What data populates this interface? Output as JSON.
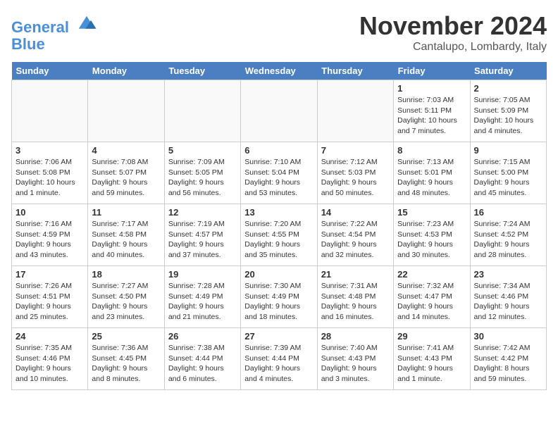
{
  "logo": {
    "line1": "General",
    "line2": "Blue"
  },
  "title": "November 2024",
  "location": "Cantalupo, Lombardy, Italy",
  "days_header": [
    "Sunday",
    "Monday",
    "Tuesday",
    "Wednesday",
    "Thursday",
    "Friday",
    "Saturday"
  ],
  "weeks": [
    [
      {
        "day": "",
        "info": ""
      },
      {
        "day": "",
        "info": ""
      },
      {
        "day": "",
        "info": ""
      },
      {
        "day": "",
        "info": ""
      },
      {
        "day": "",
        "info": ""
      },
      {
        "day": "1",
        "info": "Sunrise: 7:03 AM\nSunset: 5:11 PM\nDaylight: 10 hours\nand 7 minutes."
      },
      {
        "day": "2",
        "info": "Sunrise: 7:05 AM\nSunset: 5:09 PM\nDaylight: 10 hours\nand 4 minutes."
      }
    ],
    [
      {
        "day": "3",
        "info": "Sunrise: 7:06 AM\nSunset: 5:08 PM\nDaylight: 10 hours\nand 1 minute."
      },
      {
        "day": "4",
        "info": "Sunrise: 7:08 AM\nSunset: 5:07 PM\nDaylight: 9 hours\nand 59 minutes."
      },
      {
        "day": "5",
        "info": "Sunrise: 7:09 AM\nSunset: 5:05 PM\nDaylight: 9 hours\nand 56 minutes."
      },
      {
        "day": "6",
        "info": "Sunrise: 7:10 AM\nSunset: 5:04 PM\nDaylight: 9 hours\nand 53 minutes."
      },
      {
        "day": "7",
        "info": "Sunrise: 7:12 AM\nSunset: 5:03 PM\nDaylight: 9 hours\nand 50 minutes."
      },
      {
        "day": "8",
        "info": "Sunrise: 7:13 AM\nSunset: 5:01 PM\nDaylight: 9 hours\nand 48 minutes."
      },
      {
        "day": "9",
        "info": "Sunrise: 7:15 AM\nSunset: 5:00 PM\nDaylight: 9 hours\nand 45 minutes."
      }
    ],
    [
      {
        "day": "10",
        "info": "Sunrise: 7:16 AM\nSunset: 4:59 PM\nDaylight: 9 hours\nand 43 minutes."
      },
      {
        "day": "11",
        "info": "Sunrise: 7:17 AM\nSunset: 4:58 PM\nDaylight: 9 hours\nand 40 minutes."
      },
      {
        "day": "12",
        "info": "Sunrise: 7:19 AM\nSunset: 4:57 PM\nDaylight: 9 hours\nand 37 minutes."
      },
      {
        "day": "13",
        "info": "Sunrise: 7:20 AM\nSunset: 4:55 PM\nDaylight: 9 hours\nand 35 minutes."
      },
      {
        "day": "14",
        "info": "Sunrise: 7:22 AM\nSunset: 4:54 PM\nDaylight: 9 hours\nand 32 minutes."
      },
      {
        "day": "15",
        "info": "Sunrise: 7:23 AM\nSunset: 4:53 PM\nDaylight: 9 hours\nand 30 minutes."
      },
      {
        "day": "16",
        "info": "Sunrise: 7:24 AM\nSunset: 4:52 PM\nDaylight: 9 hours\nand 28 minutes."
      }
    ],
    [
      {
        "day": "17",
        "info": "Sunrise: 7:26 AM\nSunset: 4:51 PM\nDaylight: 9 hours\nand 25 minutes."
      },
      {
        "day": "18",
        "info": "Sunrise: 7:27 AM\nSunset: 4:50 PM\nDaylight: 9 hours\nand 23 minutes."
      },
      {
        "day": "19",
        "info": "Sunrise: 7:28 AM\nSunset: 4:49 PM\nDaylight: 9 hours\nand 21 minutes."
      },
      {
        "day": "20",
        "info": "Sunrise: 7:30 AM\nSunset: 4:49 PM\nDaylight: 9 hours\nand 18 minutes."
      },
      {
        "day": "21",
        "info": "Sunrise: 7:31 AM\nSunset: 4:48 PM\nDaylight: 9 hours\nand 16 minutes."
      },
      {
        "day": "22",
        "info": "Sunrise: 7:32 AM\nSunset: 4:47 PM\nDaylight: 9 hours\nand 14 minutes."
      },
      {
        "day": "23",
        "info": "Sunrise: 7:34 AM\nSunset: 4:46 PM\nDaylight: 9 hours\nand 12 minutes."
      }
    ],
    [
      {
        "day": "24",
        "info": "Sunrise: 7:35 AM\nSunset: 4:46 PM\nDaylight: 9 hours\nand 10 minutes."
      },
      {
        "day": "25",
        "info": "Sunrise: 7:36 AM\nSunset: 4:45 PM\nDaylight: 9 hours\nand 8 minutes."
      },
      {
        "day": "26",
        "info": "Sunrise: 7:38 AM\nSunset: 4:44 PM\nDaylight: 9 hours\nand 6 minutes."
      },
      {
        "day": "27",
        "info": "Sunrise: 7:39 AM\nSunset: 4:44 PM\nDaylight: 9 hours\nand 4 minutes."
      },
      {
        "day": "28",
        "info": "Sunrise: 7:40 AM\nSunset: 4:43 PM\nDaylight: 9 hours\nand 3 minutes."
      },
      {
        "day": "29",
        "info": "Sunrise: 7:41 AM\nSunset: 4:43 PM\nDaylight: 9 hours\nand 1 minute."
      },
      {
        "day": "30",
        "info": "Sunrise: 7:42 AM\nSunset: 4:42 PM\nDaylight: 8 hours\nand 59 minutes."
      }
    ]
  ]
}
